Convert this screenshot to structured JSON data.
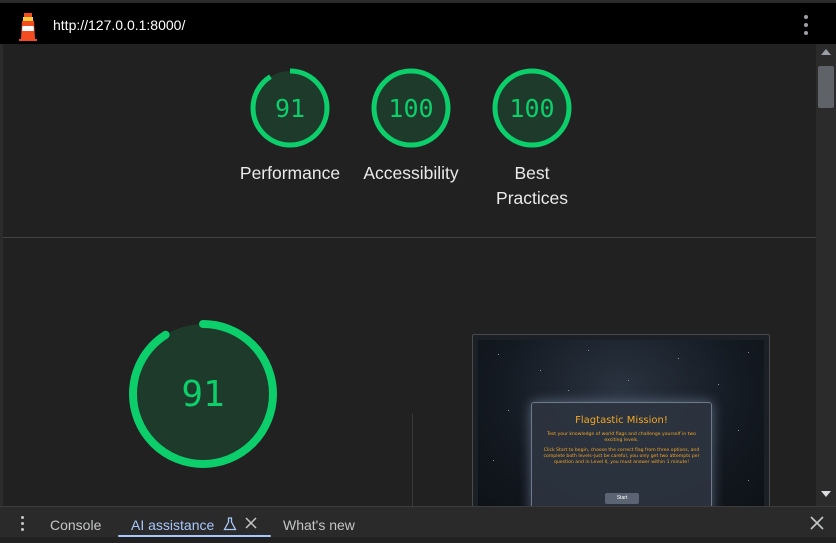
{
  "header": {
    "url": "http://127.0.0.1:8000/",
    "logo_icon": "lighthouse-icon",
    "menu_icon": "more-vert-icon"
  },
  "summary_gauges": [
    {
      "score": "91",
      "label_line1": "Performance",
      "label_line2": "",
      "fraction": 0.91
    },
    {
      "score": "100",
      "label_line1": "Accessibility",
      "label_line2": "",
      "fraction": 1.0
    },
    {
      "score": "100",
      "label_line1": "Best",
      "label_line2": "Practices",
      "fraction": 1.0
    }
  ],
  "main_gauge": {
    "score": "91",
    "fraction": 0.91
  },
  "screenshot": {
    "title": "Flagtastic Mission!",
    "text1": "Test your knowledge of world flags and challenge yourself in two exciting levels.",
    "text2": "Click Start to begin, choose the correct flag from three options, and complete both levels–just be careful, you only get two attempts per question and in Level II, you must answer within 1 minute!",
    "button": "Start"
  },
  "drawer": {
    "tabs": [
      "Console",
      "AI assistance",
      "What's new"
    ],
    "active_tab": "AI assistance"
  },
  "colors": {
    "pass_green": "#0cce6b",
    "gauge_fill": "#1d3a2a",
    "accent_blue": "#a8c7fa"
  }
}
